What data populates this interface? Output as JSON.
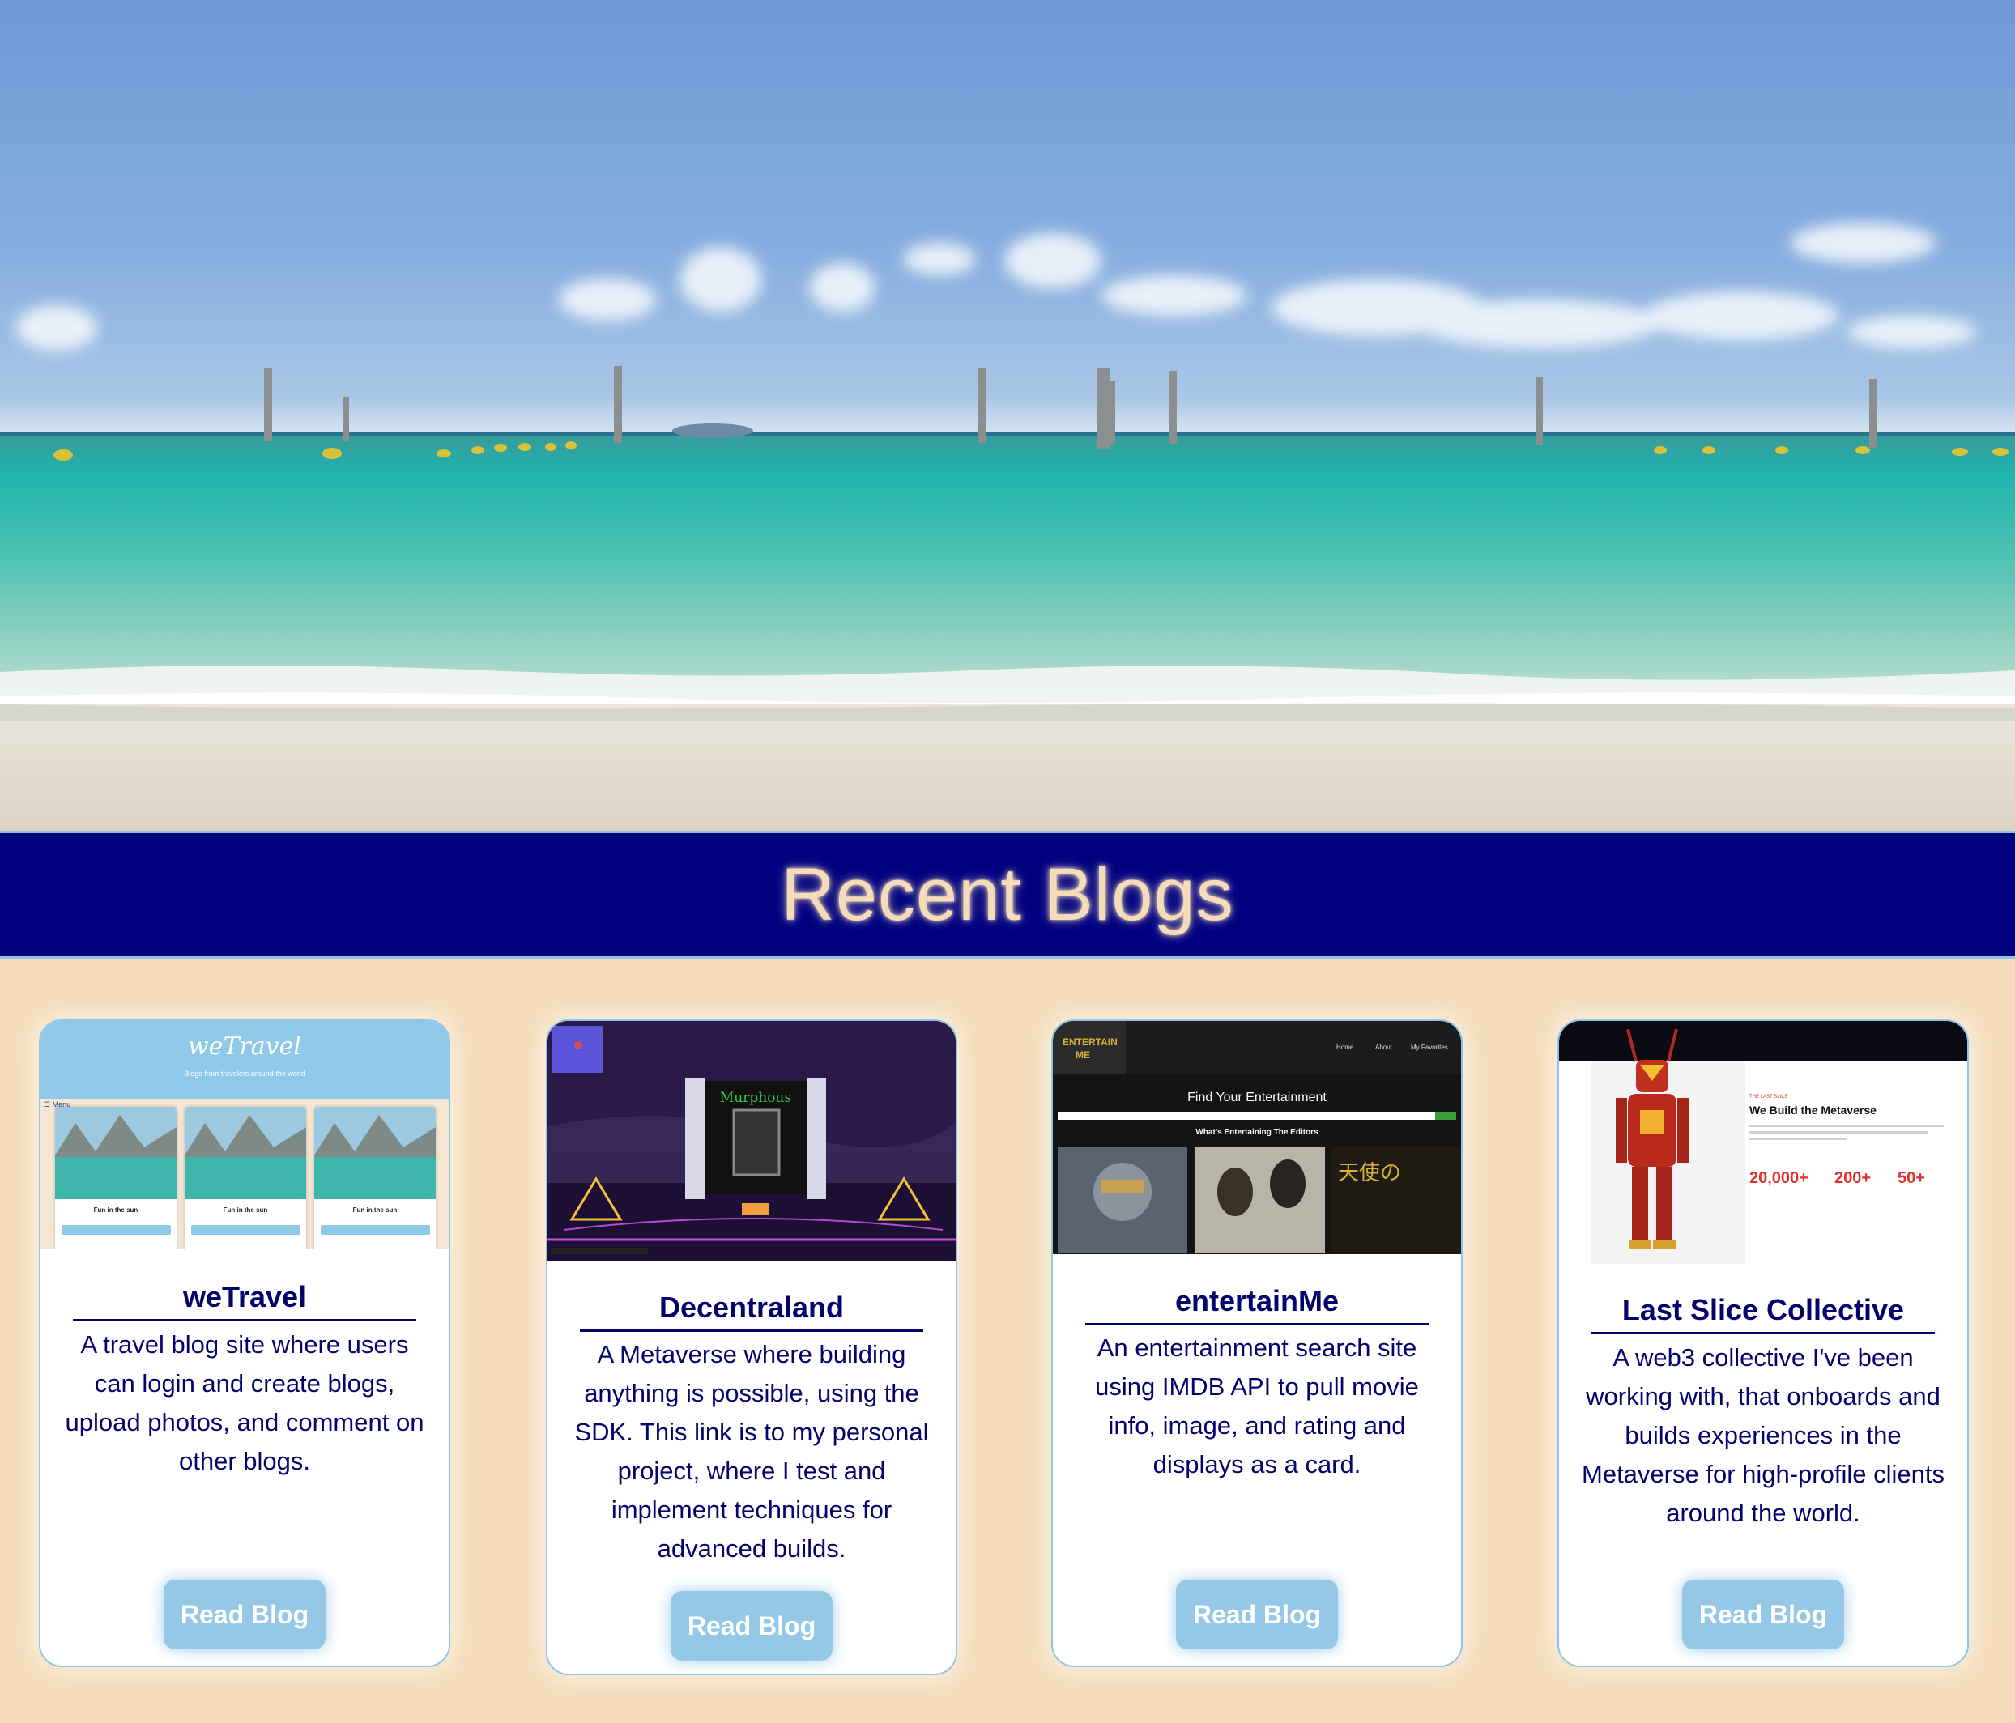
{
  "hero": {
    "alt": "beach"
  },
  "banner": {
    "title": "Recent Blogs"
  },
  "colors": {
    "navy": "#010180",
    "text": "#03036e",
    "button": "#94c8e6",
    "background": "#f4dcba",
    "cardBorder": "#8fc3e8"
  },
  "cards": [
    {
      "title": "weTravel",
      "description": "A travel blog site where users can login and create blogs, upload photos, and comment on other blogs.",
      "button": "Read Blog",
      "thumb": {
        "logo": "weTravel",
        "subtitle": "Blogs from travelers around the world",
        "menu": "☰ Menu",
        "post_title": "Fun in the sun",
        "post_button": "Read Blog"
      }
    },
    {
      "title": "Decentraland",
      "description": "A Metaverse where building anything is possible, using the SDK. This link is to my personal project, where I test and implement techniques for advanced builds.",
      "button": "Read Blog",
      "thumb": {
        "sign": "Murphous"
      }
    },
    {
      "title": "entertainMe",
      "description": "An entertainment search site using IMDB API to pull movie info, image, and rating and displays as a card.",
      "button": "Read Blog",
      "thumb": {
        "logo": "ENTERTAIN ME",
        "nav": [
          "Home",
          "About",
          "My Favorites"
        ],
        "heading": "Find Your Entertainment",
        "subheading": "What's Entertaining The Editors"
      }
    },
    {
      "title": "Last Slice Collective",
      "description": "A web3 collective I've been working with, that onboards and builds experiences in the Metaverse for high-profile clients around the world.",
      "button": "Read Blog",
      "thumb": {
        "heading": "We Build the Metaverse",
        "stats": [
          "20,000+",
          "200+",
          "50+"
        ]
      }
    }
  ]
}
